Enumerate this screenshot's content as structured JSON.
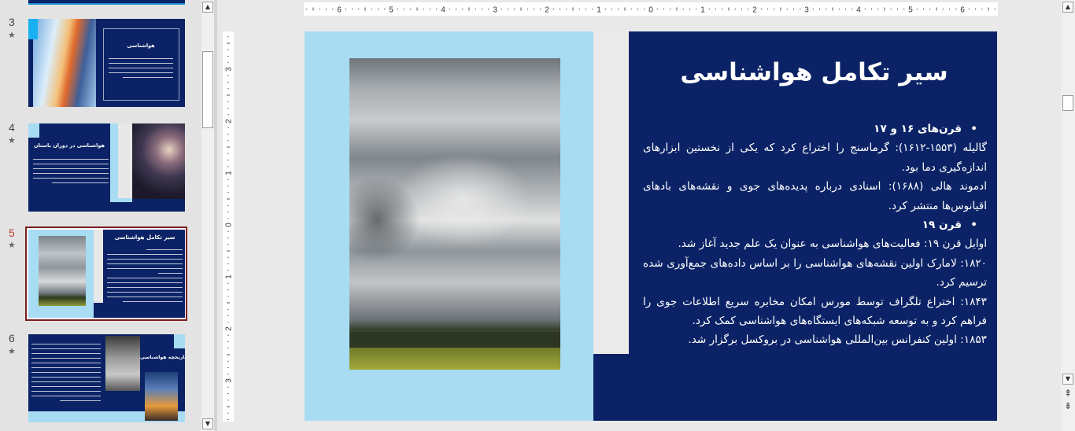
{
  "thumbnails": [
    {
      "number": "3",
      "title": "هواشناسی",
      "selected": false
    },
    {
      "number": "4",
      "title": "هواشناسی در دوران باستان",
      "selected": false
    },
    {
      "number": "5",
      "title": "سیر تکامل هواشناسی",
      "selected": true
    },
    {
      "number": "6",
      "title": "تاریخچه هواشناسی",
      "selected": false
    }
  ],
  "star": "★",
  "hruler": [
    "6",
    "5",
    "4",
    "3",
    "2",
    "1",
    "0",
    "1",
    "2",
    "3",
    "4",
    "5",
    "6"
  ],
  "vruler": [
    "3",
    "2",
    "1",
    "0",
    "1",
    "2",
    "3"
  ],
  "slide": {
    "title": "سیر تکامل هواشناسی",
    "section1_heading": "قرن‌های ۱۶ و ۱۷",
    "section1_p1": "گالیله (۱۵۵۳-۱۶۱۲): گرماسنج را اختراع کرد که یکی از نخستین ابزارهای اندازه‌گیری دما بود.",
    "section1_p2": "ادموند هالی (۱۶۸۸): اسنادی درباره پدیده‌های جوی و نقشه‌های بادهای اقیانوس‌ها منتشر کرد.",
    "section2_heading": "قرن ۱۹",
    "section2_p1": "اوایل قرن ۱۹: فعالیت‌های هواشناسی به عنوان یک علم جدید آغاز شد.",
    "section2_p2": "۱۸۲۰: لامارک اولین نقشه‌های هواشناسی را بر اساس داده‌های جمع‌آوری شده ترسیم کرد.",
    "section2_p3": "۱۸۴۳: اختراع تلگراف توسط مورس امکان مخابره سریع اطلاعات جوی را فراهم کرد و به توسعه شبکه‌های ایستگاه‌های هواشناسی کمک کرد.",
    "section2_p4": "۱۸۵۳: اولین کنفرانس بین‌المللی هواشناسی در بروکسل برگزار شد."
  },
  "colors": {
    "slide_bg": "#0b2366",
    "accent_light": "#a8dcf3",
    "selection": "#7a1e1e",
    "slide_number_selected": "#c0392b"
  },
  "icons": {
    "scroll_up": "▲",
    "scroll_down": "▼",
    "prev_slide": "⇞",
    "next_slide": "⇟"
  }
}
